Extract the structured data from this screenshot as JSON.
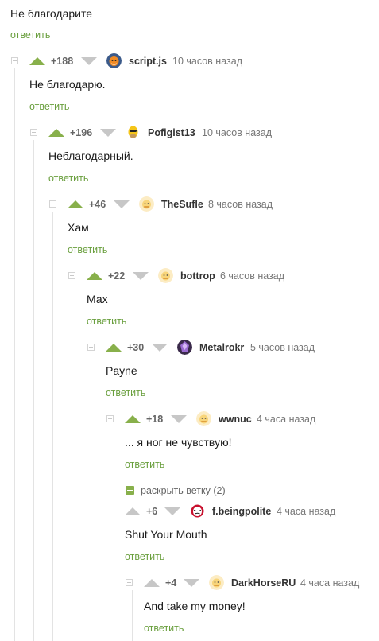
{
  "root_comment": {
    "text": "Не благодарите",
    "reply": "ответить"
  },
  "comments": [
    {
      "rating": "+188",
      "nick": "script.js",
      "time": "10 часов назад",
      "text": "Не благодарю.",
      "reply": "ответить",
      "avatar": "fox-avatar"
    },
    {
      "rating": "+196",
      "nick": "Pofigist13",
      "time": "10 часов назад",
      "text": "Неблагодарный.",
      "reply": "ответить",
      "avatar": "homer-avatar"
    },
    {
      "rating": "+46",
      "nick": "TheSufle",
      "time": "8 часов назад",
      "text": "Хам",
      "reply": "ответить",
      "avatar": "default-avatar"
    },
    {
      "rating": "+22",
      "nick": "bottrop",
      "time": "6 часов назад",
      "text": "Мах",
      "reply": "ответить",
      "avatar": "default-avatar"
    },
    {
      "rating": "+30",
      "nick": "Metalrokr",
      "time": "5 часов назад",
      "text": "Payne",
      "reply": "ответить",
      "avatar": "crystal-avatar"
    },
    {
      "rating": "+18",
      "nick": "wwnuc",
      "time": "4 часа назад",
      "text": "... я ног не чувствую!",
      "reply": "ответить",
      "avatar": "default-avatar"
    },
    {
      "rating": "+6",
      "nick": "f.beingpolite",
      "time": "4 часа назад",
      "text": "Shut Your Mouth",
      "reply": "ответить",
      "avatar": "mask-avatar"
    },
    {
      "rating": "+4",
      "nick": "DarkHorseRU",
      "time": "4 часа назад",
      "text": "And take my money!",
      "reply": "ответить",
      "avatar": "default-avatar"
    }
  ],
  "expand_branch": {
    "label": "раскрыть ветку (2)"
  },
  "colors": {
    "accent": "#88b04b",
    "reply_link": "#6a9f3e",
    "arrow_grey": "#c7c7c7",
    "thread_line": "#e3e3e3"
  }
}
